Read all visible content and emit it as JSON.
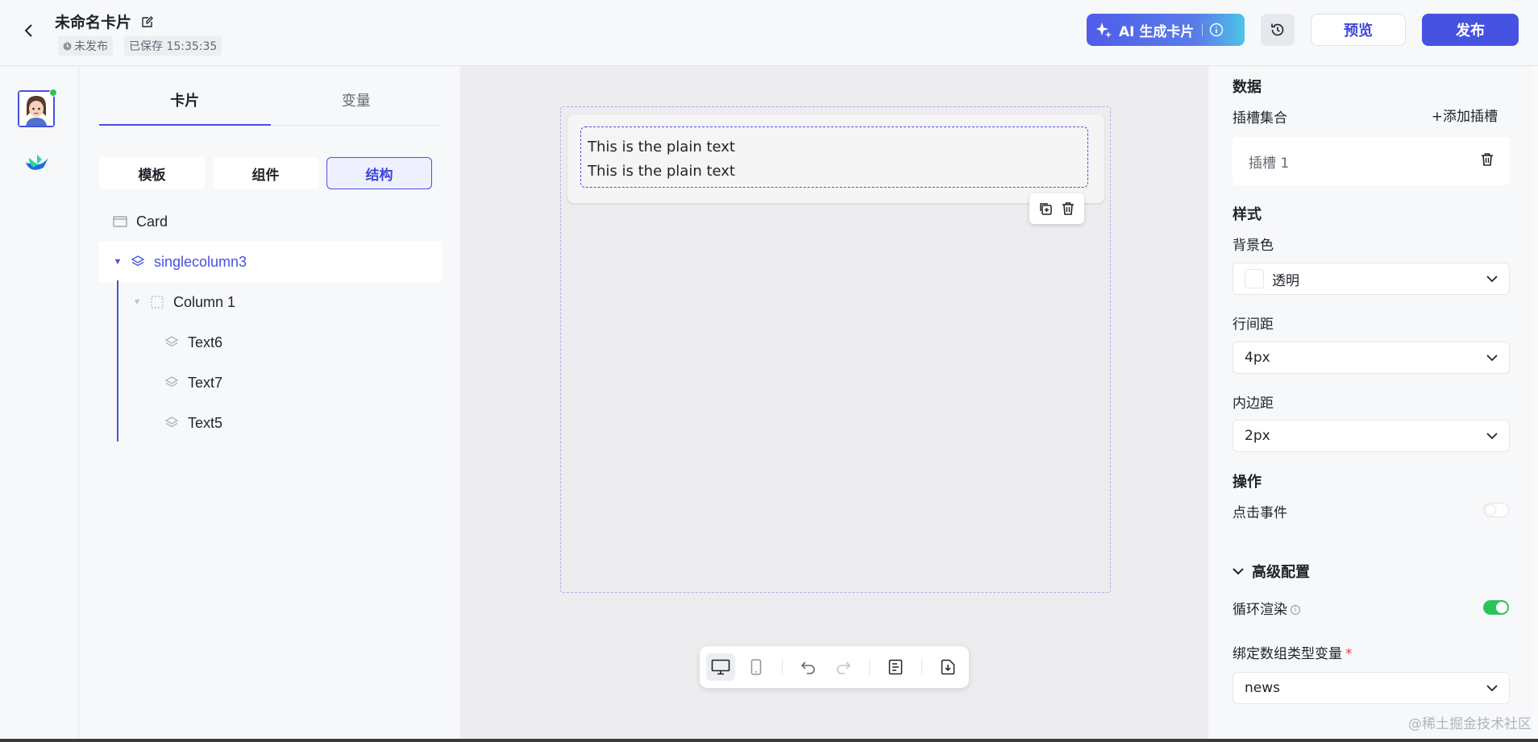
{
  "header": {
    "title": "未命名卡片",
    "status_unpublished": "未发布",
    "saved_text": "已保存 15:35:35",
    "ai_button": "AI 生成卡片",
    "preview_button": "预览",
    "publish_button": "发布"
  },
  "panel": {
    "tabs": [
      "卡片",
      "变量"
    ],
    "segments": [
      "模板",
      "组件",
      "结构"
    ],
    "tree": {
      "card": "Card",
      "singlecolumn": "singlecolumn3",
      "column": "Column 1",
      "texts": [
        "Text6",
        "Text7",
        "Text5"
      ]
    }
  },
  "canvas": {
    "lines": [
      "This is the plain text",
      "This is the plain text"
    ]
  },
  "props": {
    "data_title": "数据",
    "slots_label": "插槽集合",
    "add_slot": "+添加插槽",
    "slot_name": "插槽 1",
    "style_title": "样式",
    "bg_label": "背景色",
    "bg_value": "透明",
    "line_gap_label": "行间距",
    "line_gap_value": "4px",
    "padding_label": "内边距",
    "padding_value": "2px",
    "action_title": "操作",
    "click_label": "点击事件",
    "click_enabled": false,
    "advanced_title": "高级配置",
    "loop_label": "循环渲染",
    "loop_enabled": true,
    "bind_label": "绑定数组类型变量",
    "bind_value": "news"
  },
  "watermark": "@稀土掘金技术社区",
  "colors": {
    "accent": "#4652e0",
    "toggle_on": "#2cc35c",
    "background": "#f4f5f8"
  }
}
